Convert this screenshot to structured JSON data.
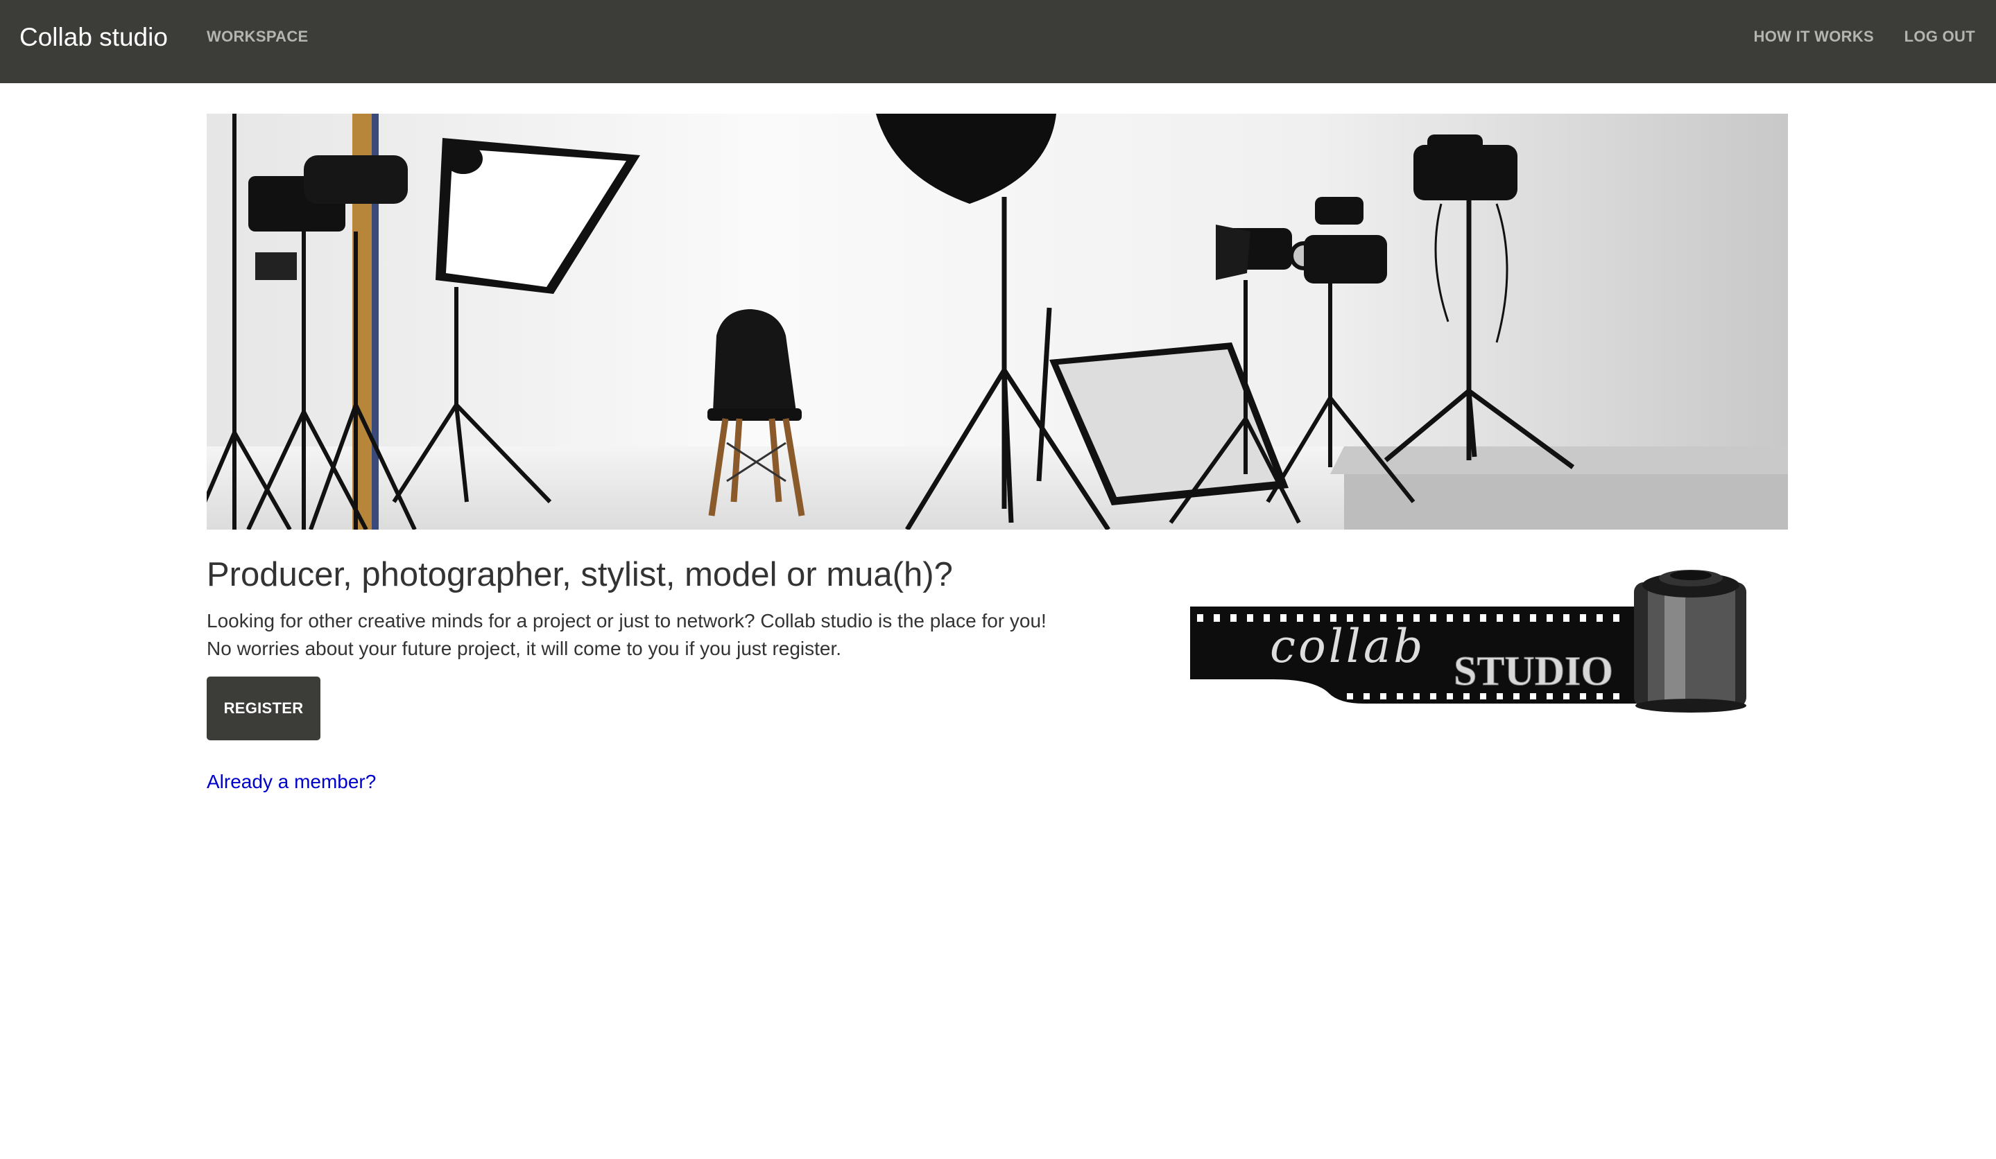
{
  "navbar": {
    "brand": "Collab studio",
    "links": {
      "workspace": "WORKSPACE",
      "how_it_works": "HOW IT WORKS",
      "log_out": "LOG OUT"
    }
  },
  "hero": {
    "image": "photo-studio-lights-with-chair"
  },
  "main": {
    "headline": "Producer, photographer, stylist, model or mua(h)?",
    "description_line1": "Looking for other creative minds for a project or just to network? Collab studio is the place for you!",
    "description_line2": "No worries about your future project, it will come to you if you just register.",
    "register_label": "REGISTER",
    "member_link": "Already a member?"
  },
  "logo": {
    "script_text": "collab",
    "block_text": "STUDIO"
  },
  "colors": {
    "navbar_bg": "#3c3c38",
    "button_bg": "#3c3c38",
    "link": "#0000cc",
    "text": "#333333"
  }
}
